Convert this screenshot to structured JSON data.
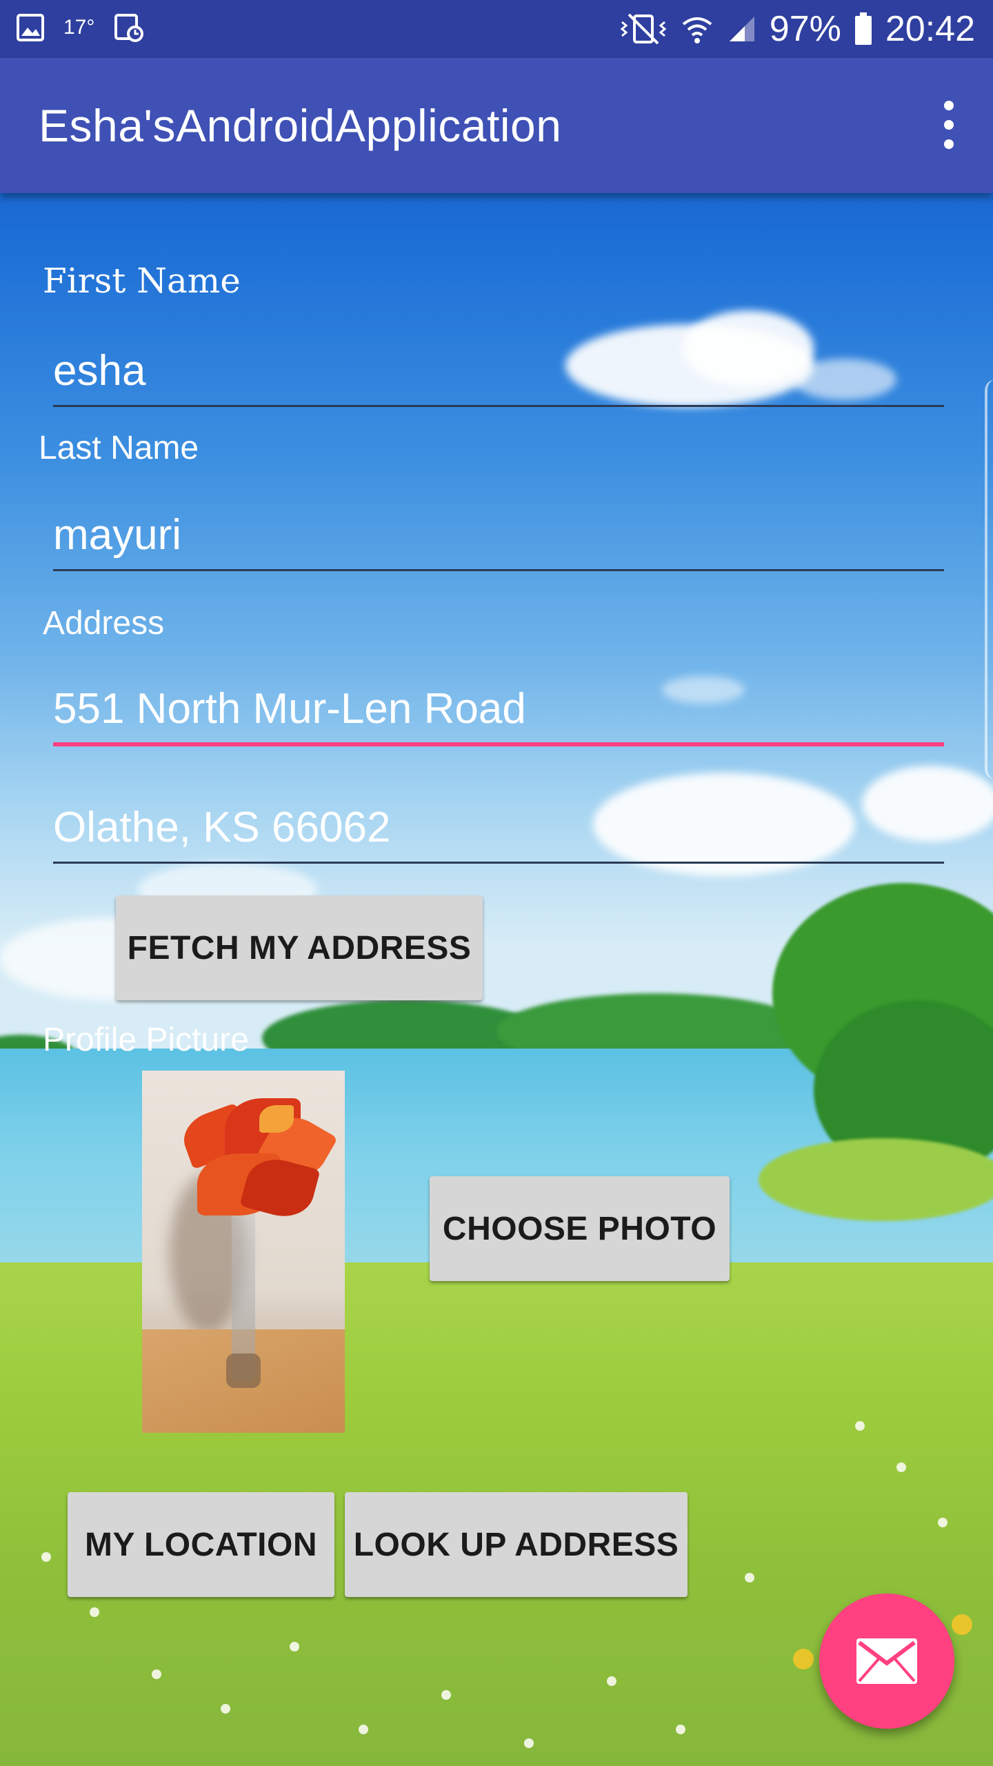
{
  "status_bar": {
    "temperature": "17°",
    "battery": "97%",
    "time": "20:42",
    "icons": [
      "gallery-icon",
      "calendar-clock-icon",
      "vibrate-icon",
      "wifi-icon",
      "signal-icon",
      "battery-icon"
    ]
  },
  "app_bar": {
    "title": "Esha'sAndroidApplication",
    "menu_icon": "overflow-menu-icon"
  },
  "form": {
    "first_name_label": "First Name",
    "first_name_value": "esha",
    "last_name_label": "Last Name",
    "last_name_value": "mayuri",
    "address_label": "Address",
    "address_line1_value": "551 North Mur-Len Road",
    "address_line2_value": "Olathe, KS 66062",
    "fetch_address_label": "FETCH MY ADDRESS",
    "profile_picture_label": "Profile Picture",
    "choose_photo_label": "CHOOSE PHOTO",
    "my_location_label": "MY LOCATION",
    "look_up_address_label": "LOOK UP ADDRESS"
  },
  "fab": {
    "icon": "email-icon"
  },
  "colors": {
    "status_bar": "#2f3f9f",
    "app_bar": "#3f51b5",
    "accent": "#ff4081",
    "button": "#d6d6d6"
  }
}
